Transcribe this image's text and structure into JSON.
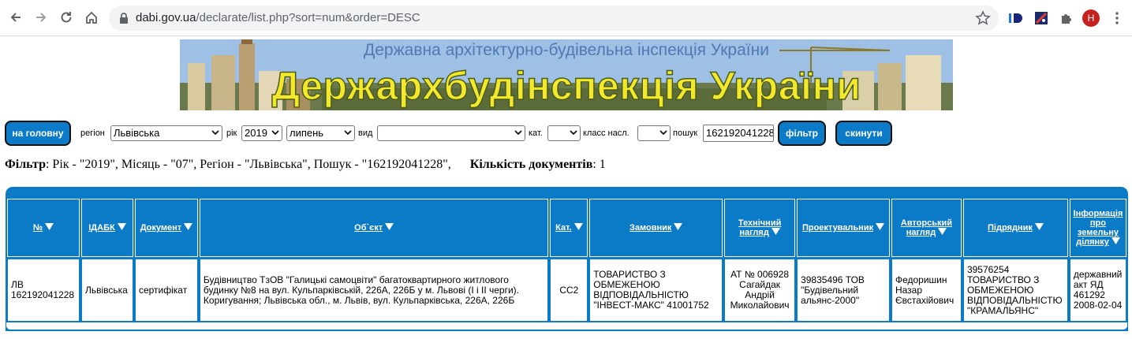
{
  "browser": {
    "url_host": "dabi.gov.ua",
    "url_path": "/declarate/list.php?sort=num&order=DESC",
    "avatar_letter": "H"
  },
  "banner": {
    "subtitle": "Державна архітектурно-будівельна інспекція України",
    "title": "Держархбудінспекція України"
  },
  "filters": {
    "home_button": "на головну",
    "region_label": "регіон",
    "region_value": "Львівська",
    "year_label": "рік",
    "year_value": "2019",
    "month_value": "липень",
    "type_label": "вид",
    "type_value": "",
    "category_label": "кат.",
    "category_value": "",
    "class_label": "класс насл.",
    "class_value": "",
    "search_label": "пошук",
    "search_value": "162192041228",
    "filter_button": "фільтр",
    "reset_button": "скинути"
  },
  "summary": {
    "filter_label": "Фільтр",
    "filter_text": ": Рік - \"2019\", Місяць - \"07\", Регіон - \"Львівська\", Пошук - \"162192041228\",",
    "count_label": "Кількість документів",
    "count_value": ": 1"
  },
  "table": {
    "headers": [
      "№",
      "ІДАБК",
      "Документ",
      "Об`єкт",
      "Кат.",
      "Замовник",
      "Технічний нагляд",
      "Проектувальник",
      "Авторський нагляд",
      "Підрядник",
      "Інформація про земельну ділянку"
    ],
    "rows": [
      {
        "num": "ЛВ 162192041228",
        "idabk": "Львівська",
        "document": "сертифікат",
        "object": "Будівництво ТзОВ \"Галицькі самоцвіти\" багатоквартирного житлового будинку №8 на вул. Кульпарківській, 226А, 226Б у м. Львові (І і ІІ черги). Коригування; Львівська обл., м. Львів, вул. Кульпарківська, 226А, 226Б",
        "category": "СС2",
        "customer": "ТОВАРИСТВО З ОБМЕЖЕНОЮ ВІДПОВІДАЛЬНІСТЮ \"ІНВЕСТ-МАКС\" 41001752",
        "tech_supervision": "АТ № 006928 Сагайдак Андрій Миколайович",
        "designer": "39835496 ТОВ \"Будівельний альянс-2000\"",
        "author_supervision": "Федоришин Назар Євстахійович",
        "contractor": "39576254 ТОВАРИСТВО З ОБМЕЖЕНОЮ ВІДПОВІДАЛЬНІСТЮ \"КРАМАЛЬЯНС\"",
        "land_info": "державний акт ЯД 461292 2008-02-04"
      }
    ]
  },
  "colors": {
    "accent": "#0b7bc8",
    "banner_title": "#f3e82a",
    "banner_subtitle": "#4f79b3"
  }
}
